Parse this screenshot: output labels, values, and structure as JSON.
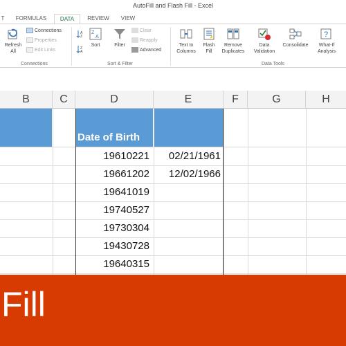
{
  "window": {
    "title": "AutoFill and Flash Fill - Excel"
  },
  "tabs": [
    {
      "label": "T"
    },
    {
      "label": "FORMULAS"
    },
    {
      "label": "DATA"
    },
    {
      "label": "REVIEW"
    },
    {
      "label": "VIEW"
    }
  ],
  "ribbon": {
    "connections_group": {
      "refresh_label": "Refresh All",
      "connections_label": "Connections",
      "properties_label": "Properties",
      "edit_links_label": "Edit Links",
      "group_label": "Connections"
    },
    "sort_filter_group": {
      "sort_label": "Sort",
      "filter_label": "Filter",
      "clear_label": "Clear",
      "reapply_label": "Reapply",
      "advanced_label": "Advanced",
      "group_label": "Sort & Filter"
    },
    "data_tools_group": {
      "text_to_columns_label": "Text to Columns",
      "flash_fill_label": "Flash Fill",
      "remove_duplicates_label": "Remove Duplicates",
      "data_validation_label": "Data Validation",
      "consolidate_label": "Consolidate",
      "what_if_label": "What-If Analysis",
      "group_label": "Data Tools"
    }
  },
  "columns": [
    "B",
    "C",
    "D",
    "E",
    "F",
    "G",
    "H"
  ],
  "sheet": {
    "header_d": "Date of Birth",
    "column_d_values": [
      "19610221",
      "19661202",
      "19641019",
      "19740527",
      "19730304",
      "19430728",
      "19640315"
    ],
    "column_e_values": [
      "02/21/1961",
      "12/02/1966"
    ]
  },
  "banner": {
    "text": "Fill"
  },
  "colors": {
    "accent": "#217346",
    "table_header": "#5b9bd5",
    "banner": "#d83b01"
  }
}
